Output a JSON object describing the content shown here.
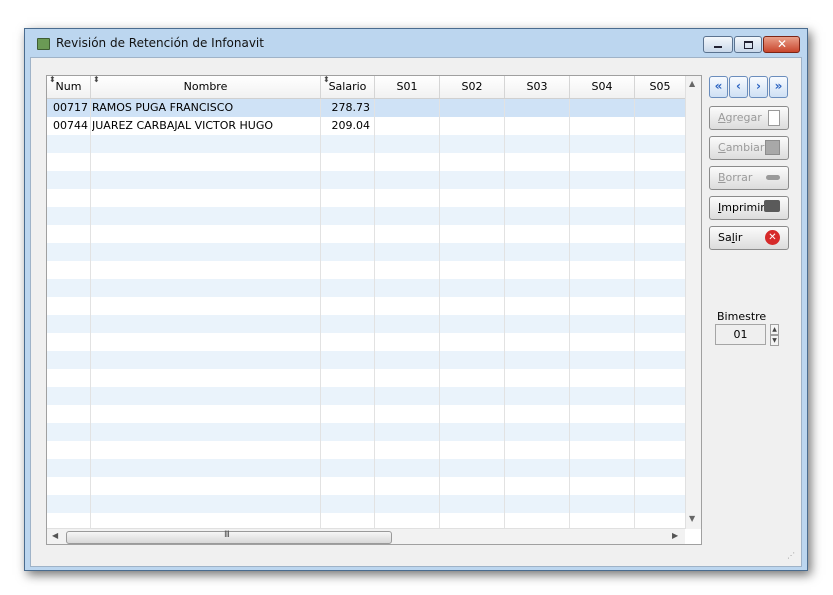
{
  "window": {
    "title": "Revisión de Retención de Infonavit"
  },
  "grid": {
    "columns": [
      {
        "key": "num",
        "label": "Num"
      },
      {
        "key": "nombre",
        "label": "Nombre"
      },
      {
        "key": "salario",
        "label": "Salario"
      },
      {
        "key": "s01",
        "label": "S01"
      },
      {
        "key": "s02",
        "label": "S02"
      },
      {
        "key": "s03",
        "label": "S03"
      },
      {
        "key": "s04",
        "label": "S04"
      },
      {
        "key": "s05",
        "label": "S05"
      }
    ],
    "rows": [
      {
        "num": "00717",
        "nombre": "RAMOS PUGA FRANCISCO",
        "salario": "278.73",
        "s01": "",
        "s02": "",
        "s03": "",
        "s04": "",
        "s05": ""
      },
      {
        "num": "00744",
        "nombre": "JUAREZ CARBAJAL VICTOR HUGO",
        "salario": "209.04",
        "s01": "",
        "s02": "",
        "s03": "",
        "s04": "",
        "s05": ""
      }
    ],
    "scroll_grip": "III"
  },
  "nav": {
    "first": "«",
    "prev": "‹",
    "next": "›",
    "last": "»"
  },
  "actions": {
    "agregar": {
      "pre": "",
      "ul": "A",
      "post": "gregar",
      "enabled": false,
      "icon": "new-document-icon"
    },
    "cambiar": {
      "pre": "",
      "ul": "C",
      "post": "ambiar",
      "enabled": false,
      "icon": "edit-image-icon"
    },
    "borrar": {
      "pre": "",
      "ul": "B",
      "post": "orrar",
      "enabled": false,
      "icon": "minus-pill-icon"
    },
    "imprimir": {
      "pre": "",
      "ul": "I",
      "post": "mprimir",
      "enabled": true,
      "icon": "printer-icon"
    },
    "salir": {
      "pre": "Sa",
      "ul": "l",
      "post": "ir",
      "enabled": true,
      "icon": "close-red-icon"
    }
  },
  "bimestre": {
    "label": "Bimestre",
    "value": "01"
  },
  "colors": {
    "accent": "#2a62c0",
    "row_alt": "#eaf3fb",
    "row_selected": "#cfe2f6",
    "close_red": "#d62a2a"
  }
}
